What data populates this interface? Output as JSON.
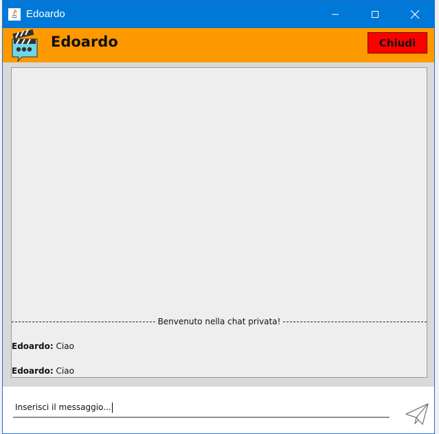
{
  "window": {
    "title": "Edoardo",
    "icon": "java-icon",
    "controls": [
      "minimize-icon",
      "maximize-icon",
      "close-icon"
    ]
  },
  "header": {
    "name": "Edoardo",
    "close_button_label": "Chiudi",
    "logo_icon": "clapperboard-chat-icon",
    "background": "#ff9900",
    "close_button_color": "#ff0000"
  },
  "chat": {
    "welcome": "Benvenuto nella chat privata!",
    "messages": [
      {
        "sender": "Edoardo:",
        "text": " Ciao"
      },
      {
        "sender": "Edoardo:",
        "text": " Ciao"
      }
    ]
  },
  "composer": {
    "placeholder": "Inserisci il messaggio...",
    "send_icon": "paper-plane-icon"
  },
  "colors": {
    "titlebar": "#0078d7"
  }
}
